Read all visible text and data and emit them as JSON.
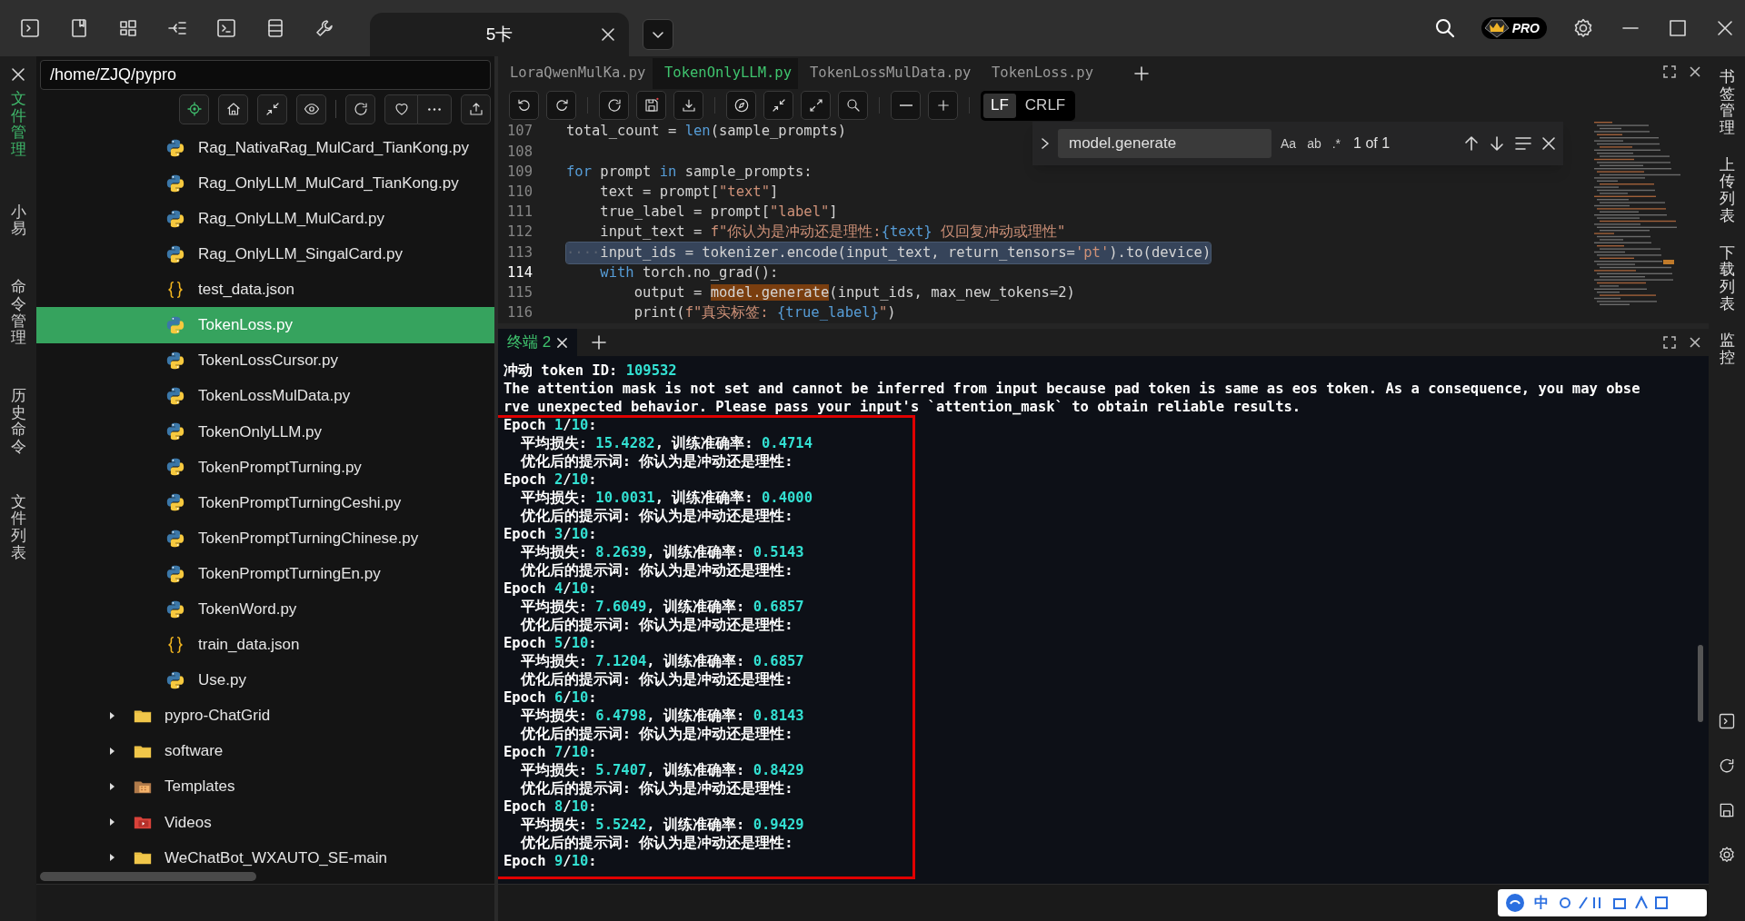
{
  "titlebar": {
    "tabs": [
      {
        "label": "5卡",
        "selected": true
      }
    ],
    "badge": "PRO"
  },
  "left_rail": {
    "items": [
      {
        "label": "文件管理",
        "selected": true
      },
      {
        "label": "小易",
        "selected": false
      },
      {
        "label": "命令管理",
        "selected": false
      },
      {
        "label": "历史命令",
        "selected": false
      },
      {
        "label": "文件列表",
        "selected": false
      }
    ]
  },
  "file_panel": {
    "path": "/home/ZJQ/pypro",
    "files": [
      {
        "name": "Rag_NativaRag_MulCard_TianKong.py",
        "kind": "python",
        "selected": false
      },
      {
        "name": "Rag_OnlyLLM_MulCard_TianKong.py",
        "kind": "python",
        "selected": false
      },
      {
        "name": "Rag_OnlyLLM_MulCard.py",
        "kind": "python",
        "selected": false
      },
      {
        "name": "Rag_OnlyLLM_SingalCard.py",
        "kind": "python",
        "selected": false
      },
      {
        "name": "test_data.json",
        "kind": "json",
        "selected": false
      },
      {
        "name": "TokenLoss.py",
        "kind": "python",
        "selected": true
      },
      {
        "name": "TokenLossCursor.py",
        "kind": "python",
        "selected": false
      },
      {
        "name": "TokenLossMulData.py",
        "kind": "python",
        "selected": false
      },
      {
        "name": "TokenOnlyLLM.py",
        "kind": "python",
        "selected": false
      },
      {
        "name": "TokenPromptTurning.py",
        "kind": "python",
        "selected": false
      },
      {
        "name": "TokenPromptTurningCeshi.py",
        "kind": "python",
        "selected": false
      },
      {
        "name": "TokenPromptTurningChinese.py",
        "kind": "python",
        "selected": false
      },
      {
        "name": "TokenPromptTurningEn.py",
        "kind": "python",
        "selected": false
      },
      {
        "name": "TokenWord.py",
        "kind": "python",
        "selected": false
      },
      {
        "name": "train_data.json",
        "kind": "json",
        "selected": false
      },
      {
        "name": "Use.py",
        "kind": "python",
        "selected": false
      }
    ],
    "folders": [
      {
        "name": "pypro-ChatGrid",
        "kind": "folder",
        "expanded": false
      },
      {
        "name": "software",
        "kind": "folder",
        "expanded": false
      },
      {
        "name": "Templates",
        "kind": "templates",
        "expanded": false
      },
      {
        "name": "Videos",
        "kind": "videos",
        "expanded": false
      },
      {
        "name": "WeChatBot_WXAUTO_SE-main",
        "kind": "folder",
        "expanded": false
      }
    ]
  },
  "editor": {
    "tabs": [
      {
        "label": "LoraQwenMulKa.py",
        "selected": false
      },
      {
        "label": "TokenOnlyLLM.py",
        "selected": true
      },
      {
        "label": "TokenLossMulData.py",
        "selected": false
      },
      {
        "label": "TokenLoss.py",
        "selected": false
      }
    ],
    "line_endings": [
      {
        "label": "LF",
        "selected": true
      },
      {
        "label": "CRLF",
        "selected": false
      }
    ],
    "find": {
      "query": "model.generate",
      "options": [
        "Aa",
        "ab",
        ".*"
      ],
      "count": "1 of 1"
    },
    "lines": [
      {
        "number": "107",
        "current": false,
        "highlighted": false,
        "segments": [
          {
            "text": "total_count = ",
            "kind": "plain"
          },
          {
            "text": "len",
            "kind": "keyword"
          },
          {
            "text": "(sample_prompts)",
            "kind": "plain"
          }
        ]
      },
      {
        "number": "108",
        "current": false,
        "highlighted": false
      },
      {
        "number": "109",
        "current": false,
        "highlighted": false,
        "segments": [
          {
            "text": "for",
            "kind": "keyword"
          },
          {
            "text": " prompt ",
            "kind": "plain"
          },
          {
            "text": "in",
            "kind": "keyword"
          },
          {
            "text": " sample_prompts:",
            "kind": "plain"
          }
        ]
      },
      {
        "number": "110",
        "current": false,
        "highlighted": false,
        "segments": [
          {
            "text": "    text = prompt[",
            "kind": "plain"
          },
          {
            "text": "\"text\"",
            "kind": "string"
          },
          {
            "text": "]",
            "kind": "plain"
          }
        ]
      },
      {
        "number": "111",
        "current": false,
        "highlighted": false,
        "segments": [
          {
            "text": "    true_label = prompt[",
            "kind": "plain"
          },
          {
            "text": "\"label\"",
            "kind": "string"
          },
          {
            "text": "]",
            "kind": "plain"
          }
        ]
      },
      {
        "number": "112",
        "current": false,
        "highlighted": false,
        "segments": [
          {
            "text": "    input_text = ",
            "kind": "plain"
          },
          {
            "text": "f\"你认为是冲动还是理性:",
            "kind": "string"
          },
          {
            "text": "{text}",
            "kind": "keyword"
          },
          {
            "text": " 仅回复冲动或理性\"",
            "kind": "string"
          }
        ]
      },
      {
        "number": "113",
        "current": false,
        "highlighted": true,
        "segments": [
          {
            "text": "····",
            "kind": "whitespace"
          },
          {
            "text": "input_ids = tokenizer.encode(input_text, return_tensors=",
            "kind": "plain"
          },
          {
            "text": "'pt'",
            "kind": "string"
          },
          {
            "text": ").to(device)",
            "kind": "plain"
          }
        ]
      },
      {
        "number": "114",
        "current": true,
        "highlighted": false,
        "segments": [
          {
            "text": "    with",
            "kind": "keyword"
          },
          {
            "text": " torch.no_grad():",
            "kind": "plain"
          }
        ]
      },
      {
        "number": "115",
        "current": false,
        "highlighted": false,
        "segments": [
          {
            "text": "        output = ",
            "kind": "plain"
          },
          {
            "text": "model.generate",
            "kind": "match"
          },
          {
            "text": "(input_ids, max_new_tokens=2)",
            "kind": "plain"
          }
        ]
      },
      {
        "number": "116",
        "current": false,
        "highlighted": false,
        "segments": [
          {
            "text": "        print(",
            "kind": "plain"
          },
          {
            "text": "f\"真实标签: ",
            "kind": "string"
          },
          {
            "text": "{true_label}",
            "kind": "keyword"
          },
          {
            "text": "\"",
            "kind": "string"
          },
          {
            "text": ")",
            "kind": "plain"
          }
        ]
      }
    ]
  },
  "terminal": {
    "tabs": [
      {
        "label": "终端 2",
        "selected": true
      }
    ],
    "output": [
      [
        {
          "text": "冲动 token ID: ",
          "accent": false
        },
        {
          "text": "109532",
          "accent": true
        }
      ],
      [
        {
          "text": "The attention mask is not set and cannot be inferred from input because pad token is same as eos token. As a consequence, you may obse",
          "accent": false
        }
      ],
      [
        {
          "text": "rve unexpected behavior. Please pass your input's `attention_mask` to obtain reliable results.",
          "accent": false
        }
      ]
    ],
    "marked_output": [
      [
        {
          "text": "Epoch ",
          "accent": false
        },
        {
          "text": "1",
          "accent": true
        },
        {
          "text": "/",
          "accent": false
        },
        {
          "text": "10",
          "accent": true
        },
        {
          "text": ":",
          "accent": false
        }
      ],
      [
        {
          "text": "  平均损失: ",
          "accent": false
        },
        {
          "text": "15.4282",
          "accent": true
        },
        {
          "text": ", 训练准确率: ",
          "accent": false
        },
        {
          "text": "0.4714",
          "accent": true
        }
      ],
      [
        {
          "text": "  优化后的提示词: 你认为是冲动还是理性:",
          "accent": false
        }
      ],
      [
        {
          "text": "Epoch ",
          "accent": false
        },
        {
          "text": "2",
          "accent": true
        },
        {
          "text": "/",
          "accent": false
        },
        {
          "text": "10",
          "accent": true
        },
        {
          "text": ":",
          "accent": false
        }
      ],
      [
        {
          "text": "  平均损失: ",
          "accent": false
        },
        {
          "text": "10.0031",
          "accent": true
        },
        {
          "text": ", 训练准确率: ",
          "accent": false
        },
        {
          "text": "0.4000",
          "accent": true
        }
      ],
      [
        {
          "text": "  优化后的提示词: 你认为是冲动还是理性:",
          "accent": false
        }
      ],
      [
        {
          "text": "Epoch ",
          "accent": false
        },
        {
          "text": "3",
          "accent": true
        },
        {
          "text": "/",
          "accent": false
        },
        {
          "text": "10",
          "accent": true
        },
        {
          "text": ":",
          "accent": false
        }
      ],
      [
        {
          "text": "  平均损失: ",
          "accent": false
        },
        {
          "text": "8.2639",
          "accent": true
        },
        {
          "text": ", 训练准确率: ",
          "accent": false
        },
        {
          "text": "0.5143",
          "accent": true
        }
      ],
      [
        {
          "text": "  优化后的提示词: 你认为是冲动还是理性:",
          "accent": false
        }
      ],
      [
        {
          "text": "Epoch ",
          "accent": false
        },
        {
          "text": "4",
          "accent": true
        },
        {
          "text": "/",
          "accent": false
        },
        {
          "text": "10",
          "accent": true
        },
        {
          "text": ":",
          "accent": false
        }
      ],
      [
        {
          "text": "  平均损失: ",
          "accent": false
        },
        {
          "text": "7.6049",
          "accent": true
        },
        {
          "text": ", 训练准确率: ",
          "accent": false
        },
        {
          "text": "0.6857",
          "accent": true
        }
      ],
      [
        {
          "text": "  优化后的提示词: 你认为是冲动还是理性:",
          "accent": false
        }
      ],
      [
        {
          "text": "Epoch ",
          "accent": false
        },
        {
          "text": "5",
          "accent": true
        },
        {
          "text": "/",
          "accent": false
        },
        {
          "text": "10",
          "accent": true
        },
        {
          "text": ":",
          "accent": false
        }
      ],
      [
        {
          "text": "  平均损失: ",
          "accent": false
        },
        {
          "text": "7.1204",
          "accent": true
        },
        {
          "text": ", 训练准确率: ",
          "accent": false
        },
        {
          "text": "0.6857",
          "accent": true
        }
      ],
      [
        {
          "text": "  优化后的提示词: 你认为是冲动还是理性:",
          "accent": false
        }
      ],
      [
        {
          "text": "Epoch ",
          "accent": false
        },
        {
          "text": "6",
          "accent": true
        },
        {
          "text": "/",
          "accent": false
        },
        {
          "text": "10",
          "accent": true
        },
        {
          "text": ":",
          "accent": false
        }
      ],
      [
        {
          "text": "  平均损失: ",
          "accent": false
        },
        {
          "text": "6.4798",
          "accent": true
        },
        {
          "text": ", 训练准确率: ",
          "accent": false
        },
        {
          "text": "0.8143",
          "accent": true
        }
      ],
      [
        {
          "text": "  优化后的提示词: 你认为是冲动还是理性:",
          "accent": false
        }
      ],
      [
        {
          "text": "Epoch ",
          "accent": false
        },
        {
          "text": "7",
          "accent": true
        },
        {
          "text": "/",
          "accent": false
        },
        {
          "text": "10",
          "accent": true
        },
        {
          "text": ":",
          "accent": false
        }
      ],
      [
        {
          "text": "  平均损失: ",
          "accent": false
        },
        {
          "text": "5.7407",
          "accent": true
        },
        {
          "text": ", 训练准确率: ",
          "accent": false
        },
        {
          "text": "0.8429",
          "accent": true
        }
      ],
      [
        {
          "text": "  优化后的提示词: 你认为是冲动还是理性:",
          "accent": false
        }
      ],
      [
        {
          "text": "Epoch ",
          "accent": false
        },
        {
          "text": "8",
          "accent": true
        },
        {
          "text": "/",
          "accent": false
        },
        {
          "text": "10",
          "accent": true
        },
        {
          "text": ":",
          "accent": false
        }
      ],
      [
        {
          "text": "  平均损失: ",
          "accent": false
        },
        {
          "text": "5.5242",
          "accent": true
        },
        {
          "text": ", 训练准确率: ",
          "accent": false
        },
        {
          "text": "0.9429",
          "accent": true
        }
      ],
      [
        {
          "text": "  优化后的提示词: 你认为是冲动还是理性:",
          "accent": false
        }
      ],
      [
        {
          "text": "Epoch ",
          "accent": false
        },
        {
          "text": "9",
          "accent": true
        },
        {
          "text": "/",
          "accent": false
        },
        {
          "text": "10",
          "accent": true
        },
        {
          "text": ":",
          "accent": false
        }
      ]
    ]
  },
  "right_rail": {
    "items": [
      {
        "label": "书签管理"
      },
      {
        "label": "上传列表"
      },
      {
        "label": "下载列表"
      },
      {
        "label": "监控"
      }
    ]
  },
  "ime_bar": {
    "label": "中"
  }
}
